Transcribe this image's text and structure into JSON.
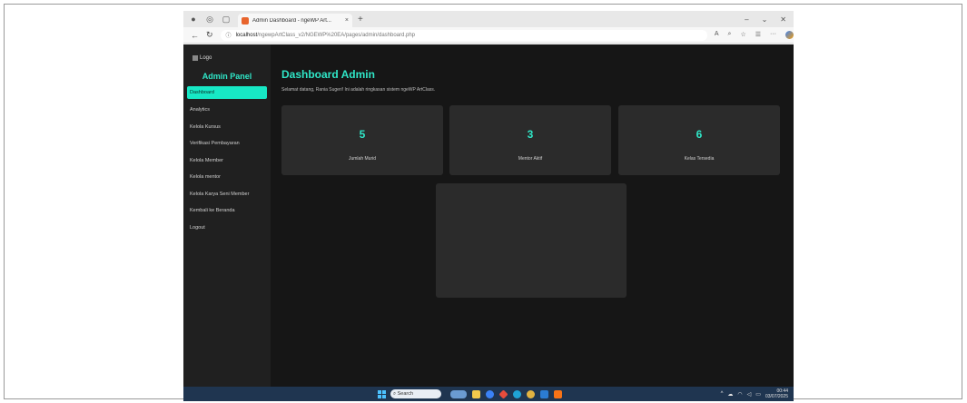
{
  "browser": {
    "tab_title": "Admin Dashboard - ngeWP Art...",
    "tab_close": "×",
    "new_tab": "+",
    "url_host": "localhost",
    "url_path": "/ngewpArtClass_v2/NGEWP%20EA/pages/admin/dashboard.php"
  },
  "sidebar": {
    "logo_text": "Logo",
    "title": "Admin Panel",
    "items": [
      {
        "label": "Dashboard",
        "active": true
      },
      {
        "label": "Analytics"
      },
      {
        "label": "Kelola Kursus"
      },
      {
        "label": "Verifikasi Pembayaran"
      },
      {
        "label": "Kelola Member"
      },
      {
        "label": "Kelola mentor"
      },
      {
        "label": "Kelola Karya Seni Member"
      },
      {
        "label": "Kembali ke Beranda"
      },
      {
        "label": "Logout"
      }
    ]
  },
  "main": {
    "title": "Dashboard Admin",
    "welcome": "Selamat datang, Rania Sugeri! Ini adalah ringkasan sistem ngeWP ArtClass.",
    "cards": [
      {
        "value": "5",
        "label": "Jumlah Murid"
      },
      {
        "value": "3",
        "label": "Mentor Aktif"
      },
      {
        "value": "6",
        "label": "Kelas Tersedia"
      }
    ]
  },
  "taskbar": {
    "search_placeholder": "Search",
    "time": "00:44",
    "date": "03/07/2025"
  },
  "colors": {
    "accent": "#2fe6c7",
    "active_item": "#17e8c5",
    "page_bg": "#161616",
    "sidebar_bg": "#202020",
    "card_bg": "#2b2b2b"
  }
}
